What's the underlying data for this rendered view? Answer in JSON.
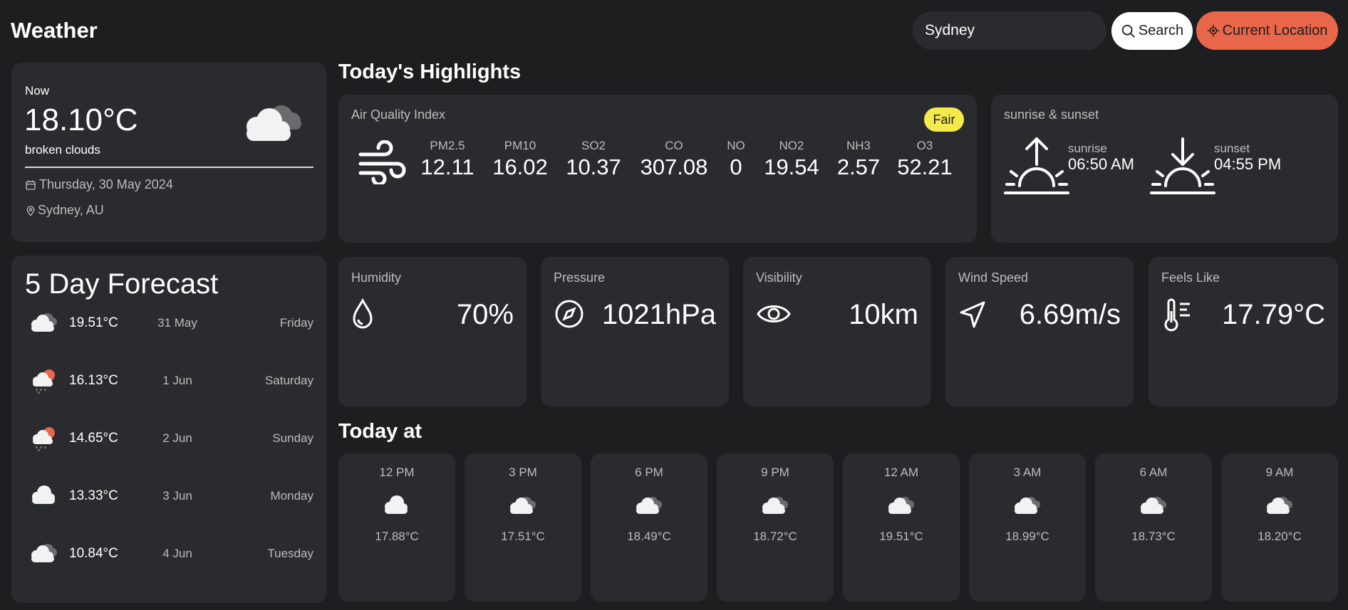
{
  "header": {
    "app_title": "Weather",
    "search_value": "Sydney",
    "search_button": "Search",
    "location_button": "Current Location"
  },
  "now": {
    "label": "Now",
    "temperature": "18.10°C",
    "description": "broken clouds",
    "date": "Thursday, 30 May 2024",
    "location": "Sydney, AU",
    "icon": "broken-clouds-icon"
  },
  "forecast": {
    "title": "5 Day Forecast",
    "days": [
      {
        "temp": "19.51°C",
        "date": "31 May",
        "weekday": "Friday",
        "icon": "broken-clouds-icon"
      },
      {
        "temp": "16.13°C",
        "date": "1 Jun",
        "weekday": "Saturday",
        "icon": "rain-sun-icon"
      },
      {
        "temp": "14.65°C",
        "date": "2 Jun",
        "weekday": "Sunday",
        "icon": "rain-sun-icon"
      },
      {
        "temp": "13.33°C",
        "date": "3 Jun",
        "weekday": "Monday",
        "icon": "cloud-icon"
      },
      {
        "temp": "10.84°C",
        "date": "4 Jun",
        "weekday": "Tuesday",
        "icon": "broken-clouds-icon"
      }
    ]
  },
  "highlights": {
    "title": "Today's Highlights",
    "aqi": {
      "label": "Air Quality Index",
      "badge": "Fair",
      "badge_color": "#f5e94c",
      "items": [
        {
          "key": "PM2.5",
          "value": "12.11"
        },
        {
          "key": "PM10",
          "value": "16.02"
        },
        {
          "key": "SO2",
          "value": "10.37"
        },
        {
          "key": "CO",
          "value": "307.08"
        },
        {
          "key": "NO",
          "value": "0"
        },
        {
          "key": "NO2",
          "value": "19.54"
        },
        {
          "key": "NH3",
          "value": "2.57"
        },
        {
          "key": "O3",
          "value": "52.21"
        }
      ]
    },
    "sun": {
      "label": "sunrise & sunset",
      "sunrise_label": "sunrise",
      "sunrise_time": "06:50 AM",
      "sunset_label": "sunset",
      "sunset_time": "04:55 PM"
    },
    "stats": {
      "humidity": {
        "label": "Humidity",
        "value": "70%",
        "icon": "droplet-icon"
      },
      "pressure": {
        "label": "Pressure",
        "value": "1021hPa",
        "icon": "compass-icon"
      },
      "visibility": {
        "label": "Visibility",
        "value": "10km",
        "icon": "eye-icon"
      },
      "wind": {
        "label": "Wind Speed",
        "value": "6.69m/s",
        "icon": "navigation-icon"
      },
      "feels": {
        "label": "Feels Like",
        "value": "17.79°C",
        "icon": "thermometer-icon"
      }
    }
  },
  "today": {
    "title": "Today at",
    "hours": [
      {
        "time": "12 PM",
        "temp": "17.88°C",
        "icon": "cloud-icon"
      },
      {
        "time": "3 PM",
        "temp": "17.51°C",
        "icon": "broken-clouds-icon"
      },
      {
        "time": "6 PM",
        "temp": "18.49°C",
        "icon": "broken-clouds-icon"
      },
      {
        "time": "9 PM",
        "temp": "18.72°C",
        "icon": "broken-clouds-icon"
      },
      {
        "time": "12 AM",
        "temp": "19.51°C",
        "icon": "broken-clouds-icon"
      },
      {
        "time": "3 AM",
        "temp": "18.99°C",
        "icon": "broken-clouds-icon"
      },
      {
        "time": "6 AM",
        "temp": "18.73°C",
        "icon": "broken-clouds-icon"
      },
      {
        "time": "9 AM",
        "temp": "18.20°C",
        "icon": "broken-clouds-icon"
      }
    ]
  },
  "colors": {
    "background": "#1d1e20",
    "card": "#2a2b2e",
    "accent": "#e8664a",
    "muted_text": "#bcbcbc"
  }
}
